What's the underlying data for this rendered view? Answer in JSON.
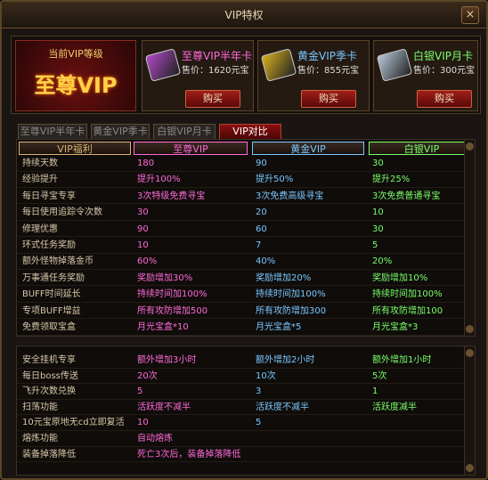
{
  "title": "VIP特权",
  "close": "×",
  "current": {
    "label": "当前VIP等级",
    "level": "至尊VIP"
  },
  "cards": [
    {
      "name": "至尊VIP半年卡",
      "price": "售价：1620元宝",
      "buy": "购买",
      "color": "#ff6ad8",
      "icon_color": "#b04ac8"
    },
    {
      "name": "黄金VIP季卡",
      "price": "售价：855元宝",
      "buy": "购买",
      "color": "#7ac8ff",
      "icon_color": "#d8b020"
    },
    {
      "name": "白银VIP月卡",
      "price": "售价：300元宝",
      "buy": "购买",
      "color": "#7aff6a",
      "icon_color": "#b8c8d8"
    }
  ],
  "tabs": [
    "至尊VIP半年卡",
    "黄金VIP季卡",
    "白银VIP月卡",
    "VIP对比"
  ],
  "headers": [
    "VIP福利",
    "至尊VIP",
    "黄金VIP",
    "白银VIP"
  ],
  "header_colors": [
    "#d8b070",
    "#ff6ad8",
    "#7ac8ff",
    "#7aff6a"
  ],
  "rows1": [
    [
      "持续天数",
      "180",
      "90",
      "30"
    ],
    [
      "经验提升",
      "提升100%",
      "提升50%",
      "提升25%"
    ],
    [
      "每日寻宝专享",
      "3次特级免费寻宝",
      "3次免费高级寻宝",
      "3次免费普通寻宝"
    ],
    [
      "每日使用追踪令次数",
      "30",
      "20",
      "10"
    ],
    [
      "修理优惠",
      "90",
      "60",
      "30"
    ],
    [
      "环式任务奖励",
      "10",
      "7",
      "5"
    ],
    [
      "额外怪物掉落金币",
      "60%",
      "40%",
      "20%"
    ],
    [
      "万事通任务奖励",
      "奖励增加30%",
      "奖励增加20%",
      "奖励增加10%"
    ],
    [
      "BUFF时间延长",
      "持续时间加100%",
      "持续时间加100%",
      "持续时间加100%"
    ],
    [
      "专项BUFF增益",
      "所有攻防增加500",
      "所有攻防增加300",
      "所有攻防增加100"
    ],
    [
      "免费领取宝盒",
      "月光宝盒*10",
      "月光宝盒*5",
      "月光宝盒*3"
    ]
  ],
  "rows2": [
    [
      "安全挂机专享",
      "额外增加3小时",
      "额外增加2小时",
      "额外增加1小时"
    ],
    [
      "每日boss传送",
      "20次",
      "10次",
      "5次"
    ],
    [
      "飞升次数兑换",
      "5",
      "3",
      "1"
    ],
    [
      "扫荡功能",
      "活跃度不减半",
      "活跃度不减半",
      "活跃度减半"
    ],
    [
      "10元宝原地无cd立即复活",
      "10",
      "5",
      ""
    ],
    [
      "熔炼功能",
      "自动熔炼",
      "",
      ""
    ],
    [
      "装备掉落降低",
      "死亡3次后，装备掉落降低",
      "",
      ""
    ]
  ]
}
